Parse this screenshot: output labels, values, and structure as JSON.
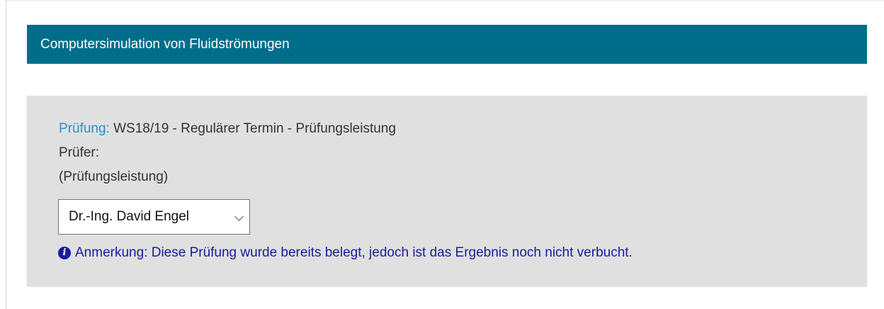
{
  "header": {
    "title": "Computersimulation von Fluidströmungen"
  },
  "exam": {
    "label_prefix": "Prüfung:",
    "label_value": " WS18/19 - Regulärer Termin - Prüfungsleistung",
    "examiner_label": "Prüfer:",
    "examiner_sub": "(Prüfungsleistung)",
    "examiner_select_value": "Dr.-Ing. David Engel",
    "note_icon": "info-circle-icon",
    "note_text": "Anmerkung: Diese Prüfung wurde bereits belegt, jedoch ist das Ergebnis noch nicht verbucht."
  },
  "colors": {
    "header_bg": "#006e8a",
    "panel_bg": "#e0e0e0",
    "label_accent": "#2b8fc8",
    "note_text": "#1a1aa0"
  }
}
